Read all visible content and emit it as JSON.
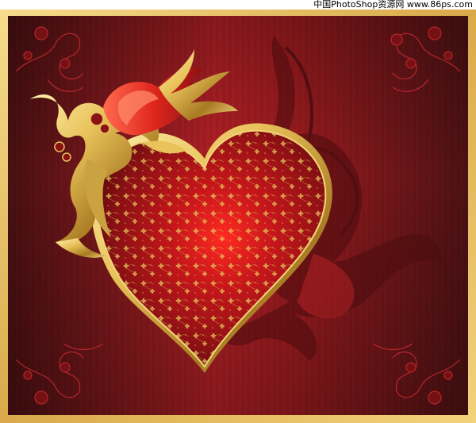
{
  "watermark": {
    "text": "中国PhotoShop资源网 www.86ps.com",
    "color": "#000000"
  },
  "artwork": {
    "subject": "ornate-heart-with-tulip",
    "colors": {
      "frame_gold": "#e2b85a",
      "background_dark": "#5c1416",
      "background_mid": "#b52126",
      "heart_red": "#9e1418",
      "heart_glow": "#ff2a22",
      "gold_ornament": "#d9b44a",
      "tulip_red": "#e0281e"
    },
    "icons": [
      "heart-icon",
      "tulip-icon",
      "floral-corner-icon",
      "flame-swirl-icon"
    ]
  }
}
